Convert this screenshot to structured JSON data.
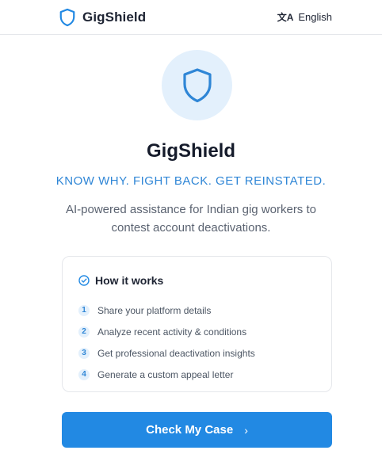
{
  "header": {
    "brand_name": "GigShield",
    "language_label": "English",
    "language_icon": "translate-icon"
  },
  "hero": {
    "icon": "shield-icon",
    "title": "GigShield",
    "tagline": "KNOW WHY. FIGHT BACK. GET REINSTATED.",
    "description": "AI-powered assistance for Indian gig workers to contest account deactivations."
  },
  "how_it_works": {
    "title": "How it works",
    "icon": "check-circle-icon",
    "steps": [
      {
        "number": "1",
        "text": "Share your platform details"
      },
      {
        "number": "2",
        "text": "Analyze recent activity & conditions"
      },
      {
        "number": "3",
        "text": "Get professional deactivation insights"
      },
      {
        "number": "4",
        "text": "Generate a custom appeal letter"
      }
    ]
  },
  "cta": {
    "label": "Check My Case",
    "icon": "chevron-right-icon"
  },
  "colors": {
    "accent": "#2289e3",
    "accent_light": "#e3f0fc",
    "tagline": "#2f86d6",
    "text_dark": "#151b2b",
    "text_muted": "#5b6371"
  }
}
